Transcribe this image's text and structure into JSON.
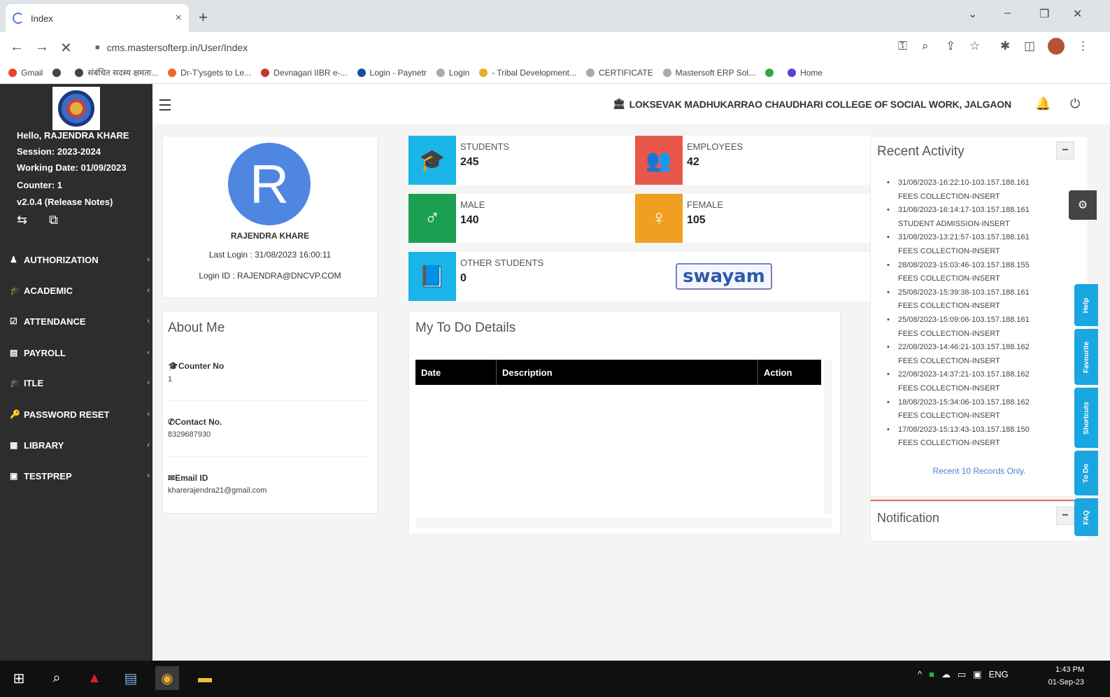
{
  "browser": {
    "tab_title": "Index",
    "tab_close": "×",
    "new_tab": "+",
    "url": "cms.mastersofterp.in/User/Index",
    "bookmarks": [
      {
        "label": "Gmail",
        "color": "#ea4335"
      },
      {
        "label": "",
        "color": "#444444"
      },
      {
        "label": "संबंधित सदस्य क्षमता...",
        "color": "#444444"
      },
      {
        "label": "Dr-T'ysgets to Le...",
        "color": "#e86a2a"
      },
      {
        "label": "Devnagari IIBR e-...",
        "color": "#c0392b"
      },
      {
        "label": "Login - Paynetr",
        "color": "#1a4fa0"
      },
      {
        "label": "Login",
        "color": "#aaaaaa"
      },
      {
        "label": "- Tribal Development...",
        "color": "#e0b020"
      },
      {
        "label": "CERTIFICATE",
        "color": "#aaaaaa"
      },
      {
        "label": "Mastersoft ERP Sol...",
        "color": "#aaaaaa"
      },
      {
        "label": "",
        "color": "#2eaa4a"
      },
      {
        "label": "Home",
        "color": "#5a3fd8"
      }
    ]
  },
  "sidebar": {
    "greeting": "Hello, RAJENDRA KHARE",
    "session": "Session: 2023-2024",
    "working_date": "Working Date: 01/09/2023",
    "counter": "Counter: 1",
    "version": "v2.0.4 (Release Notes)",
    "menu": [
      {
        "icon": "♟",
        "label": "AUTHORIZATION"
      },
      {
        "icon": "🎓",
        "label": "ACADEMIC"
      },
      {
        "icon": "☑",
        "label": "ATTENDANCE"
      },
      {
        "icon": "▤",
        "label": "PAYROLL"
      },
      {
        "icon": "🎓",
        "label": "ITLE"
      },
      {
        "icon": "🔑",
        "label": "PASSWORD RESET"
      },
      {
        "icon": "▦",
        "label": "LIBRARY"
      },
      {
        "icon": "▣",
        "label": "TESTPREP"
      }
    ]
  },
  "header": {
    "college": "LOKSEVAK MADHUKARRAO CHAUDHARI COLLEGE OF SOCIAL WORK, JALGAON"
  },
  "profile": {
    "initial": "R",
    "name": "RAJENDRA KHARE",
    "last_login": "Last Login : 31/08/2023 16:00:11",
    "login_id": "Login ID : RAJENDRA@DNCVP.COM"
  },
  "about": {
    "title": "About Me",
    "counter_label": "Counter No",
    "counter_value": "1",
    "contact_label": "Contact No.",
    "contact_value": "8329687930",
    "email_label": "Email ID",
    "email_value": "kharerajendra21@gmail.com"
  },
  "stats": [
    {
      "label": "STUDENTS",
      "value": "245",
      "color": "#1ab4e8",
      "icon": "graduation-cap"
    },
    {
      "label": "EMPLOYEES",
      "value": "42",
      "color": "#e8584a",
      "icon": "users"
    },
    {
      "label": "MALE",
      "value": "140",
      "color": "#1aa050",
      "icon": "male"
    },
    {
      "label": "FEMALE",
      "value": "105",
      "color": "#f0a020",
      "icon": "female"
    },
    {
      "label": "OTHER STUDENTS",
      "value": "0",
      "color": "#1ab4e8",
      "icon": "book"
    }
  ],
  "swayam": "swayam",
  "todo": {
    "title": "My To Do Details",
    "columns": [
      "Date",
      "Description",
      "Action"
    ]
  },
  "recent": {
    "title": "Recent Activity",
    "items": [
      {
        "time": "31/08/2023-16:22:10-103.157.188.161",
        "action": "FEES COLLECTION-INSERT"
      },
      {
        "time": "31/08/2023-16:14:17-103.157.188.161",
        "action": "STUDENT ADMISSION-INSERT"
      },
      {
        "time": "31/08/2023-13:21:57-103.157.188.161",
        "action": "FEES COLLECTION-INSERT"
      },
      {
        "time": "28/08/2023-15:03:46-103.157.188.155",
        "action": "FEES COLLECTION-INSERT"
      },
      {
        "time": "25/08/2023-15:39:38-103.157.188.161",
        "action": "FEES COLLECTION-INSERT"
      },
      {
        "time": "25/08/2023-15:09:06-103.157.188.161",
        "action": "FEES COLLECTION-INSERT"
      },
      {
        "time": "22/08/2023-14:46:21-103.157.188.162",
        "action": "FEES COLLECTION-INSERT"
      },
      {
        "time": "22/08/2023-14:37:21-103.157.188.162",
        "action": "FEES COLLECTION-INSERT"
      },
      {
        "time": "18/08/2023-15:34:06-103.157.188.162",
        "action": "FEES COLLECTION-INSERT"
      },
      {
        "time": "17/08/2023-15:13:43-103.157.188.150",
        "action": "FEES COLLECTION-INSERT"
      }
    ],
    "footer": "Recent 10 Records Only.",
    "collapse": "−"
  },
  "notification": {
    "title": "Notification",
    "collapse": "−"
  },
  "side_tabs": [
    "Help",
    "Favourite",
    "Shortcuts",
    "To Do",
    "FAQ"
  ],
  "taskbar": {
    "time": "1:43 PM",
    "date": "01-Sep-23",
    "lang": "ENG"
  }
}
